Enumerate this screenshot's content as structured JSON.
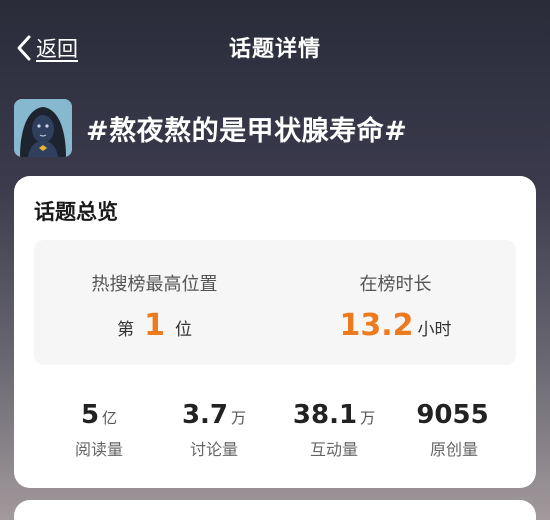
{
  "nav": {
    "back_label": "返回",
    "title": "话题详情"
  },
  "topic": {
    "name": "#熬夜熬的是甲状腺寿命#"
  },
  "overview": {
    "title": "话题总览",
    "peak_rank": {
      "label": "热搜榜最高位置",
      "prefix": "第",
      "value": "1",
      "suffix": "位"
    },
    "duration": {
      "label": "在榜时长",
      "value": "13.2",
      "suffix": "小时"
    }
  },
  "stats": [
    {
      "value": "5",
      "unit": "亿",
      "label": "阅读量"
    },
    {
      "value": "3.7",
      "unit": "万",
      "label": "讨论量"
    },
    {
      "value": "38.1",
      "unit": "万",
      "label": "互动量"
    },
    {
      "value": "9055",
      "unit": "",
      "label": "原创量"
    }
  ],
  "colors": {
    "accent": "#ee7a1e"
  },
  "icons": {
    "back": "chevron-left-icon",
    "avatar": "avatar-image"
  }
}
